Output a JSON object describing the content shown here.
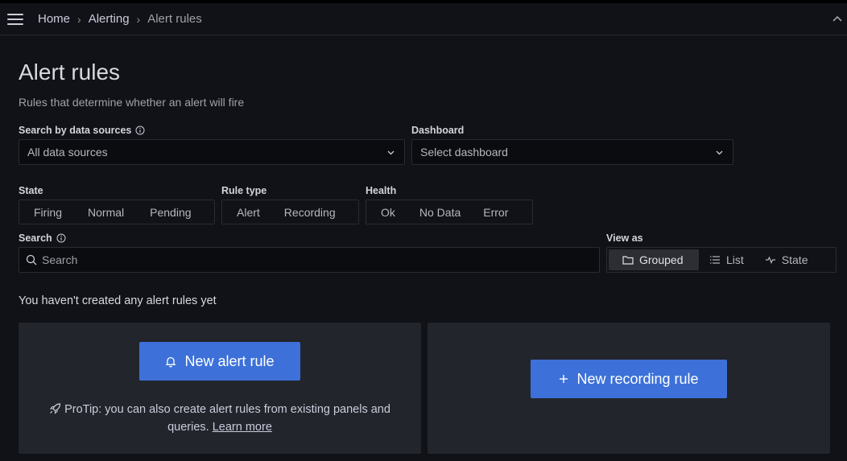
{
  "topbar": {
    "breadcrumb": [
      {
        "label": "Home"
      },
      {
        "label": "Alerting"
      },
      {
        "label": "Alert rules"
      }
    ]
  },
  "header": {
    "title": "Alert rules",
    "subtitle": "Rules that determine whether an alert will fire"
  },
  "filters": {
    "datasource": {
      "label": "Search by data sources",
      "value": "All data sources"
    },
    "dashboard": {
      "label": "Dashboard",
      "placeholder": "Select dashboard"
    },
    "state": {
      "label": "State",
      "options": [
        "Firing",
        "Normal",
        "Pending"
      ]
    },
    "rule_type": {
      "label": "Rule type",
      "options": [
        "Alert",
        "Recording"
      ]
    },
    "health": {
      "label": "Health",
      "options": [
        "Ok",
        "No Data",
        "Error"
      ]
    },
    "search": {
      "label": "Search",
      "placeholder": "Search"
    },
    "view_as": {
      "label": "View as",
      "options": [
        "Grouped",
        "List",
        "State"
      ],
      "selected": "Grouped"
    }
  },
  "empty_state": {
    "message": "You haven't created any alert rules yet",
    "new_alert_rule": "New alert rule",
    "new_recording_rule": "New recording rule",
    "protip_text_line1": "ProTip: you can also create alert rules from existing panels and",
    "protip_text_line2": "queries.",
    "learn_more": "Learn more"
  }
}
